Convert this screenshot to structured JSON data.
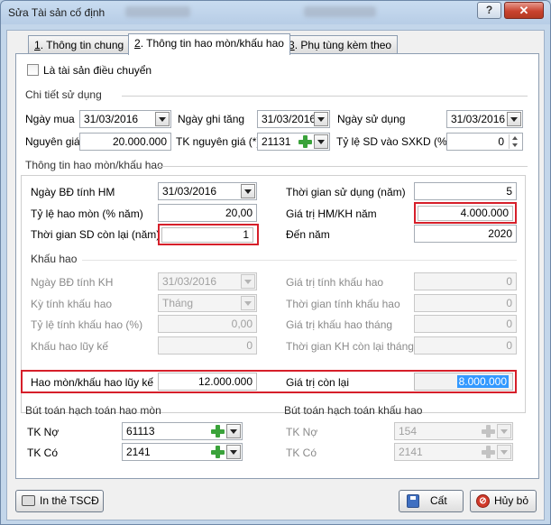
{
  "window": {
    "title": "Sửa Tài sản cố định",
    "help_label": "?",
    "close_label": "✕"
  },
  "tabs": [
    {
      "num": "1",
      "text": ". Thông tin chung"
    },
    {
      "num": "2",
      "text": ". Thông tin hao mòn/khấu hao"
    },
    {
      "num": "3",
      "text": ". Phụ tùng kèm theo"
    }
  ],
  "transfer_checkbox": {
    "label": "Là tài sản điều chuyển",
    "checked": false
  },
  "usage": {
    "section_title": "Chi tiết sử dụng",
    "ngay_mua_label": "Ngày mua",
    "ngay_mua": "31/03/2016",
    "ngay_ghi_tang_label": "Ngày ghi tăng",
    "ngay_ghi_tang": "31/03/2016",
    "ngay_su_dung_label": "Ngày sử dụng",
    "ngay_su_dung": "31/03/2016",
    "nguyen_gia_label": "Nguyên giá",
    "nguyen_gia": "20.000.000",
    "tk_nguyen_gia_label": "TK nguyên giá (*)",
    "tk_nguyen_gia": "21131",
    "ty_le_sd_label": "Tỷ lệ SD vào SXKD (%)",
    "ty_le_sd": "0"
  },
  "depreciation": {
    "section_title": "Thông tin hao mòn/khấu hao",
    "ngay_bd_label": "Ngày BĐ tính HM",
    "ngay_bd": "31/03/2016",
    "thoi_gian_sd_label": "Thời gian sử dụng (năm)",
    "thoi_gian_sd": "5",
    "ty_le_hm_label": "Tỷ lệ hao mòn (% năm)",
    "ty_le_hm": "20,00",
    "gia_tri_hm_label": "Giá trị HM/KH năm",
    "gia_tri_hm": "4.000.000",
    "tg_con_lai_label": "Thời gian SD còn lại (năm)",
    "tg_con_lai": "1",
    "den_nam_label": "Đến năm",
    "den_nam": "2020"
  },
  "amortization": {
    "section_title": "Khấu hao",
    "ngay_bd_kh_label": "Ngày BĐ tính KH",
    "ngay_bd_kh": "31/03/2016",
    "gia_tri_tinh_kh_label": "Giá trị tính khấu hao",
    "gia_tri_tinh_kh": "0",
    "ky_tinh_kh_label": "Kỳ tính khấu hao",
    "ky_tinh_kh": "Tháng",
    "tg_tinh_kh_label": "Thời gian tính khấu hao",
    "tg_tinh_kh": "0",
    "ty_le_kh_label": "Tỷ lệ tính khấu hao (%)",
    "ty_le_kh": "0,00",
    "gia_tri_kh_thang_label": "Giá trị khấu hao tháng",
    "gia_tri_kh_thang": "0",
    "kh_luy_ke_label": "Khấu hao lũy kế",
    "kh_luy_ke": "0",
    "tg_kh_con_lai_label": "Thời gian KH còn lại tháng",
    "tg_kh_con_lai": "0"
  },
  "totals": {
    "hm_luy_ke_label": "Hao mòn/khấu hao lũy kế",
    "hm_luy_ke": "12.000.000",
    "con_lai_label": "Giá trị còn lại",
    "con_lai": "8.000.000"
  },
  "entries_hm": {
    "section_title": "Bút toán hạch toán hao mòn",
    "tk_no_label": "TK Nợ",
    "tk_no": "61113",
    "tk_co_label": "TK Có",
    "tk_co": "2141"
  },
  "entries_kh": {
    "section_title": "Bút toán hạch toán khấu hao",
    "tk_no_label": "TK Nợ",
    "tk_no": "154",
    "tk_co_label": "TK Có",
    "tk_co": "2141"
  },
  "footer": {
    "print_label": "In thẻ TSCĐ",
    "save_label": "Cất",
    "cancel_label": "Hủy bỏ"
  },
  "colors": {
    "highlight_border": "#d61f2a",
    "selection": "#3399ff",
    "plus_icon": "#3aa23a"
  }
}
